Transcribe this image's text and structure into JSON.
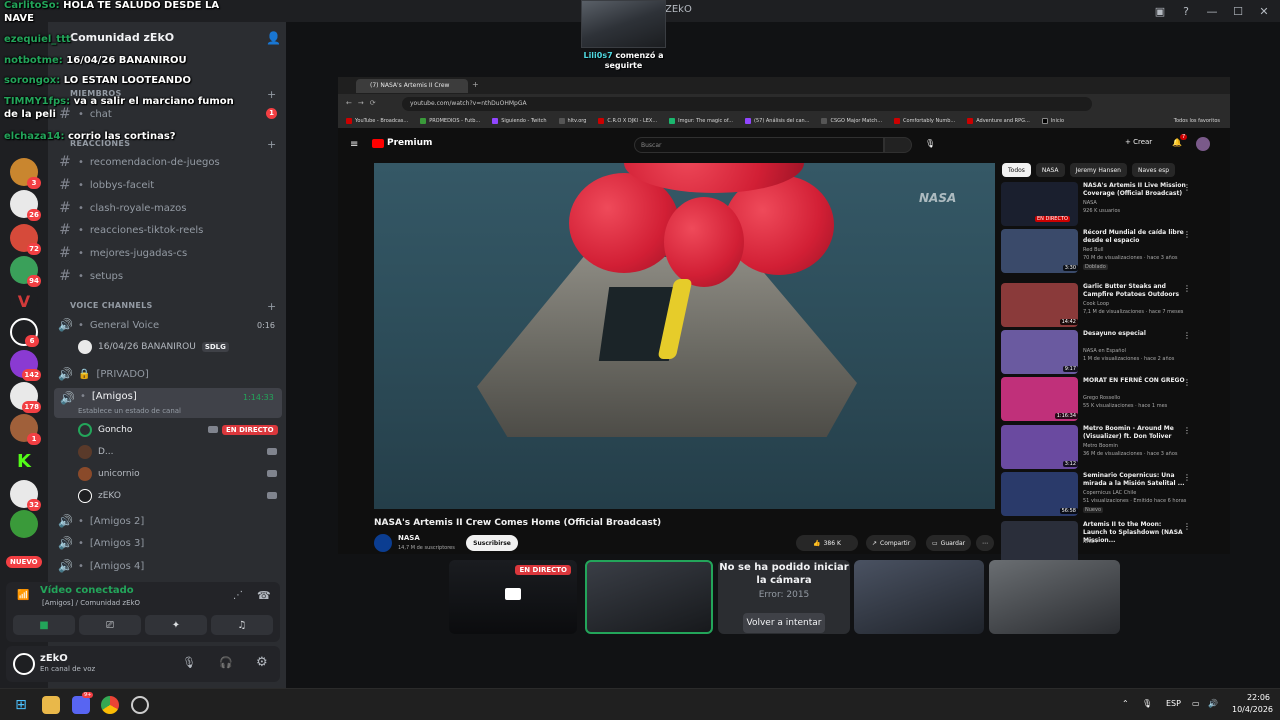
{
  "window": {
    "title": "ZEkO"
  },
  "chat": [
    {
      "nick": "CarlitoSo:",
      "text": "HOLA TE SALUDO DESDE LA"
    },
    {
      "nick": "",
      "text": "NAVE"
    },
    {
      "nick": "ezequiel_ttt",
      "text": ""
    },
    {
      "nick": "notbotme:",
      "text": "16/04/26 BANANIROU"
    },
    {
      "nick": "sorongox:",
      "text": "LO ESTAN LOOTEANDO"
    },
    {
      "nick": "TIMMY1fps:",
      "text": "va a salir el marciano fumon"
    },
    {
      "nick": "",
      "text": "de la peli"
    },
    {
      "nick": "elchaza14:",
      "text": "corrio las cortinas?"
    }
  ],
  "follow_alert": {
    "name": "Lili0s7",
    "text": "comenzó a seguirte"
  },
  "server": {
    "name": "Comunidad zEkO"
  },
  "categories": {
    "members": "MIEMBROS",
    "reactions": "REACCIONES",
    "voice": "VOICE CHANNELS"
  },
  "text_channels": [
    {
      "name": "chat",
      "badge": "1"
    },
    {
      "name": "recomendacion-de-juegos"
    },
    {
      "name": "lobbys-faceit"
    },
    {
      "name": "clash-royale-mazos"
    },
    {
      "name": "reacciones-tiktok-reels"
    },
    {
      "name": "mejores-jugadas-cs"
    },
    {
      "name": "setups"
    }
  ],
  "voice_channels": [
    {
      "name": "General Voice",
      "time": "0:16"
    },
    {
      "name": "[PRIVADO]"
    },
    {
      "name": "[Amigos]",
      "time": "1:14:33",
      "status": "Establece un estado de canal"
    },
    {
      "name": "[Amigos 2]"
    },
    {
      "name": "[Amigos 3]"
    },
    {
      "name": "[Amigos 4]"
    }
  ],
  "general_member": {
    "name": "16/04/26 BANANIROU",
    "tag": "SDLG"
  },
  "amigos_members": [
    {
      "name": "Goncho",
      "live": "EN DIRECTO"
    },
    {
      "name": "D..."
    },
    {
      "name": "unicornio"
    },
    {
      "name": "zEKO"
    }
  ],
  "server_badges": [
    "3",
    "26",
    "72",
    "94",
    "6",
    "142",
    "178",
    "1",
    "32"
  ],
  "new_label": "NUEVO",
  "voice_panel": {
    "status": "Vídeo conectado",
    "location": "[Amigos] / Comunidad zEkO"
  },
  "user": {
    "name": "zEkO",
    "status": "En canal de voz"
  },
  "browser": {
    "tab_title": "(7) NASA's Artemis II Crew",
    "url": "youtube.com/watch?v=nthDuOHMpGA",
    "bookmarks": [
      "YouTube - Broadcas...",
      "PROMEDIOS - Futb...",
      "Siguiendo - Twitch",
      "hltv.org",
      "C.R.O X DJKI - LEX...",
      "Imgur: The magic of...",
      "(57) Análisis del can...",
      "CSGO Major Match...",
      "Comfortably Numb...",
      "Adventure and RPG...",
      "Inicio"
    ],
    "all_bookmarks": "Todos los favoritos"
  },
  "youtube": {
    "logo": "Premium",
    "search_placeholder": "Buscar",
    "create": "Crear",
    "notif_count": "7",
    "watermark": "NASA",
    "video_title": "NASA's Artemis II Crew Comes Home (Official Broadcast)",
    "channel": "NASA",
    "subs": "14,7 M de suscriptores",
    "subscribe": "Suscribirse",
    "likes": "386 K",
    "share": "Compartir",
    "save": "Guardar",
    "chips": [
      "Todos",
      "NASA",
      "Jeremy Hansen",
      "Naves esp"
    ],
    "recs": [
      {
        "title": "NASA's Artemis II Live Mission Coverage (Official Broadcast)",
        "channel": "NASA",
        "meta": "926 K usuarios",
        "live": "EN DIRECTO",
        "thumb": "#1a1f2e"
      },
      {
        "title": "Récord Mundial de caída libre desde el espacio",
        "channel": "Red Bull",
        "meta": "70 M de visualizaciones · hace 3 años",
        "tag": "Doblado",
        "dur": "3:30",
        "thumb": "#3a4a6a"
      },
      {
        "title": "Garlic Butter Steaks and Campfire Potatoes Outdoors",
        "channel": "Cook Loop",
        "meta": "7,1 M de visualizaciones · hace 7 meses",
        "dur": "14:42",
        "thumb": "#8a3a3a"
      },
      {
        "title": "Desayuno especial",
        "channel": "NASA en Español",
        "meta": "1 M de visualizaciones · hace 2 años",
        "dur": "9:17",
        "thumb": "#6a5aa0"
      },
      {
        "title": "MORAT EN FERNÉ CON GREGO",
        "channel": "Grego Rossello",
        "meta": "55 K visualizaciones · hace 1 mes",
        "dur": "1:16:34",
        "thumb": "#c0307a"
      },
      {
        "title": "Metro Boomin - Around Me (Visualizer) ft. Don Toliver",
        "channel": "Metro Boomin",
        "meta": "36 M de visualizaciones · hace 3 años",
        "dur": "3:12",
        "thumb": "#6a4aa0"
      },
      {
        "title": "Seminario Copernicus: Una mirada a la Misión Satelital ...",
        "channel": "Copernicus LAC Chile",
        "meta": "51 visualizaciones · Emitido hace 6 horas",
        "tag": "Nuevo",
        "dur": "56:58",
        "thumb": "#2a3a6a"
      },
      {
        "title": "Artemis II to the Moon: Launch to Splashdown (NASA Mission...",
        "channel": "NASA",
        "meta": "",
        "thumb": "#2a2e3a"
      }
    ]
  },
  "tiles": {
    "live": "EN DIRECTO",
    "cam_error_title": "No se ha podido iniciar la cámara",
    "cam_error_code": "Error: 2015",
    "retry": "Volver a intentar"
  },
  "taskbar": {
    "lang": "ESP",
    "time": "22:06",
    "date": "10/4/2026",
    "discord_badge": "9+"
  }
}
